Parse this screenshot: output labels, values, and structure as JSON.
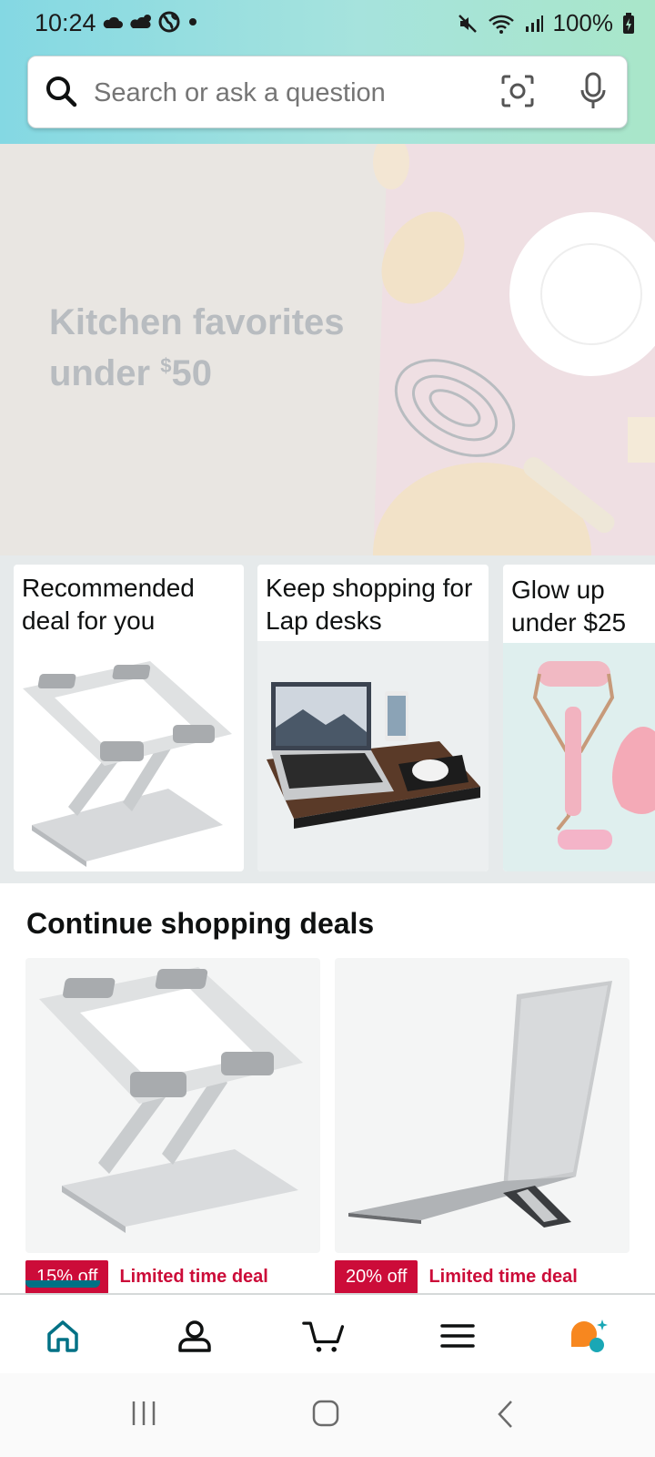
{
  "status_bar": {
    "time": "10:24",
    "battery": "100%",
    "icons": [
      "cloud-icon",
      "cloud-sync-icon",
      "globe-icon",
      "dot-icon",
      "mute-icon",
      "wifi-icon",
      "signal-icon",
      "battery-icon"
    ]
  },
  "search": {
    "placeholder": "Search or ask a question"
  },
  "hero": {
    "line1": "Kitchen favorites",
    "line2_prefix": "under ",
    "currency": "$",
    "amount": "50"
  },
  "cards": [
    {
      "title": "Recommended deal for you"
    },
    {
      "title": "Keep shopping for Lap desks"
    },
    {
      "title": "Glow up under $25"
    }
  ],
  "continue_section": {
    "title": "Continue shopping deals",
    "deals": [
      {
        "badge": "15% off",
        "label": "Limited time deal"
      },
      {
        "badge": "20% off",
        "label": "Limited time deal"
      }
    ]
  },
  "bottom_nav": [
    "home-icon",
    "account-icon",
    "cart-icon",
    "menu-icon",
    "rufus-ai-icon"
  ],
  "colors": {
    "accent_teal": "#007185",
    "deal_red": "#cc0c39",
    "header_gradient_start": "#84d8e3",
    "header_gradient_end": "#a9e6c9"
  }
}
